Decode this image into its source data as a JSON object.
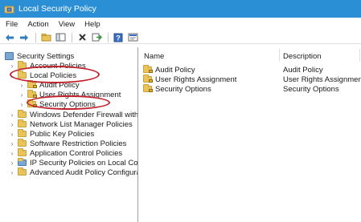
{
  "window": {
    "title": "Local Security Policy"
  },
  "menu": [
    "File",
    "Action",
    "View",
    "Help"
  ],
  "toolbar": {
    "buttons": [
      "back-icon",
      "forward-icon",
      "up-folder-icon",
      "show-hide-tree-icon",
      "delete-icon",
      "export-list-icon",
      "help-icon",
      "properties-icon"
    ]
  },
  "tree": {
    "root": "Security Settings",
    "items": [
      {
        "label": "Account Policies",
        "expanded": false
      },
      {
        "label": "Local Policies",
        "expanded": true
      },
      {
        "label": "Audit Policy",
        "child": true
      },
      {
        "label": "User Rights Assignment",
        "child": true
      },
      {
        "label": "Security Options",
        "child": true
      },
      {
        "label": "Windows Defender Firewall with Advar"
      },
      {
        "label": "Network List Manager Policies"
      },
      {
        "label": "Public Key Policies"
      },
      {
        "label": "Software Restriction Policies"
      },
      {
        "label": "Application Control Policies"
      },
      {
        "label": "IP Security Policies on Local Computer"
      },
      {
        "label": "Advanced Audit Policy Configuration"
      }
    ]
  },
  "list": {
    "columns": [
      "Name",
      "Description"
    ],
    "rows": [
      {
        "name": "Audit Policy",
        "description": "Audit Policy"
      },
      {
        "name": "User Rights Assignment",
        "description": "User Rights Assignment"
      },
      {
        "name": "Security Options",
        "description": "Security Options"
      }
    ]
  },
  "colors": {
    "titlebar": "#2b8fd6",
    "highlight": "#c0212b",
    "folder": "#e8c45a"
  }
}
